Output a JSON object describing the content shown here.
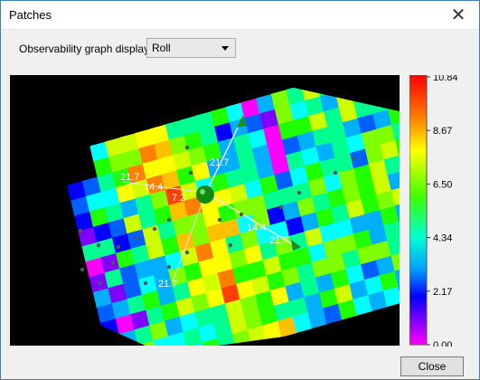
{
  "window": {
    "title": "Patches"
  },
  "controls": {
    "display_label": "Observability graph display:",
    "display_value": "Roll"
  },
  "graph_labels": [
    "21.7",
    "14.4",
    "7.2",
    "21.7",
    "14.4",
    "21.7",
    "21.7"
  ],
  "colorbar": {
    "ticks": [
      "10.84",
      "8.67",
      "6.50",
      "4.34",
      "2.17",
      "0.00"
    ]
  },
  "buttons": {
    "close_label": "Close"
  }
}
